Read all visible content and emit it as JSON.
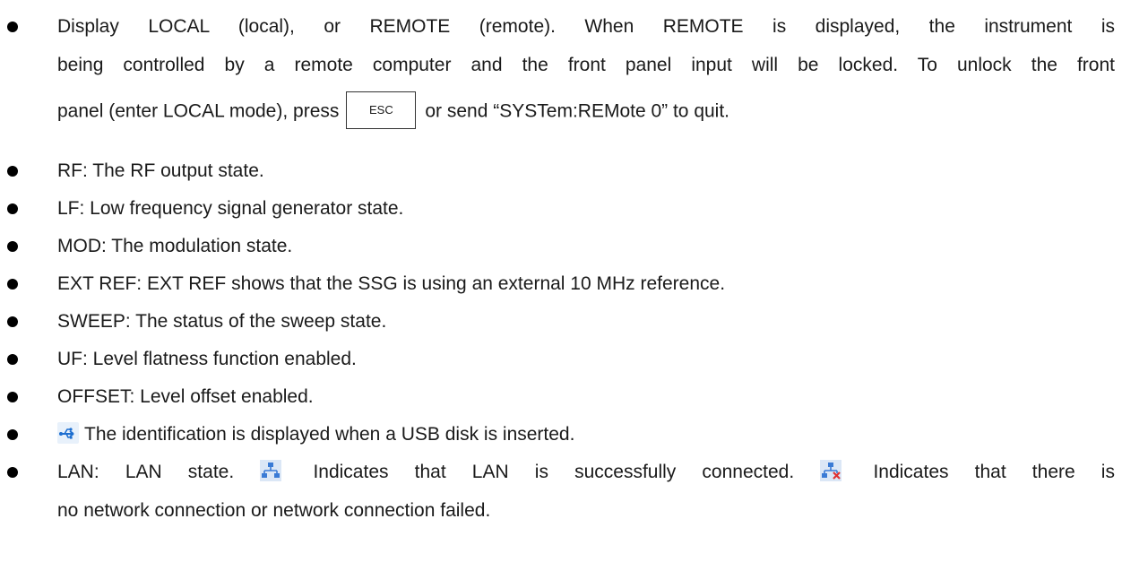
{
  "items": [
    {
      "line1": "Display LOCAL (local), or REMOTE (remote). When REMOTE is displayed, the instrument is",
      "line2": "being controlled by a remote computer and the front panel input will be locked. To unlock the front",
      "line3_pre": "panel (enter LOCAL mode), press",
      "key": "ESC",
      "line3_post": "or send “SYSTem:REMote 0” to quit."
    },
    {
      "text": "RF: The RF output state."
    },
    {
      "text": "LF: Low frequency signal generator state."
    },
    {
      "text": "MOD: The modulation state."
    },
    {
      "text": "EXT REF: EXT REF shows that the SSG is using an external 10 MHz reference."
    },
    {
      "text": "SWEEP: The status of the sweep state."
    },
    {
      "text": "UF: Level flatness function enabled."
    },
    {
      "text": "OFFSET: Level offset enabled."
    },
    {
      "icon": "usb-icon",
      "text": "The identification is displayed when a USB disk is inserted."
    },
    {
      "pre": "LAN: LAN state.",
      "icon1": "lan-connected-icon",
      "mid": "Indicates that LAN is successfully connected.",
      "icon2": "lan-disconnected-icon",
      "post": "Indicates that there is",
      "line2": "no network connection or network connection failed."
    }
  ],
  "colors": {
    "usb_icon": "#1e6fd0",
    "lan_icon": "#3a7bd5",
    "lan_error": "#e03030"
  }
}
